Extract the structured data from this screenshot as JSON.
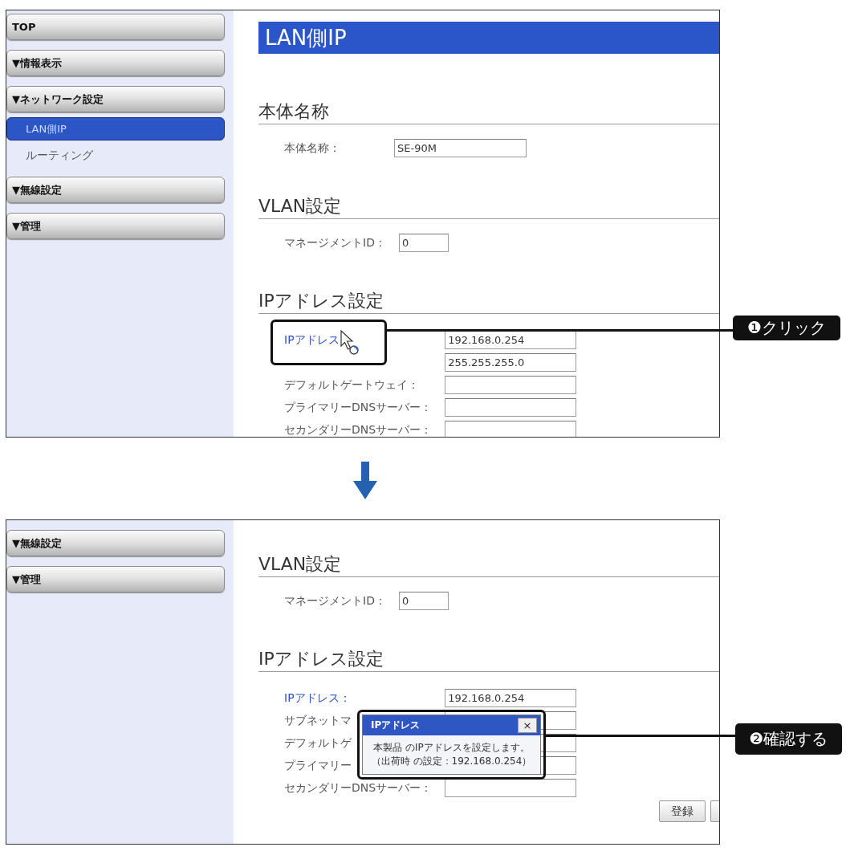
{
  "steps": [
    {
      "sidebar": {
        "items": [
          {
            "kind": "group",
            "label": "TOP",
            "selected": false
          },
          {
            "kind": "group",
            "label": "▼情報表示",
            "selected": false
          },
          {
            "kind": "group",
            "label": "▼ネットワーク設定",
            "selected": false
          },
          {
            "kind": "link",
            "label": "LAN側IP",
            "selected": true
          },
          {
            "kind": "link",
            "label": "ルーティング",
            "selected": false
          },
          {
            "kind": "group",
            "label": "▼無線設定",
            "selected": false
          },
          {
            "kind": "group",
            "label": "▼管理",
            "selected": false
          }
        ]
      },
      "page": {
        "title": "LAN側IP",
        "sections": [
          {
            "heading": "本体名称",
            "fields": [
              {
                "label": "本体名称：",
                "value": "SE-90M",
                "highlighted": false
              }
            ]
          },
          {
            "heading": "VLAN設定",
            "fields": [
              {
                "label": "マネージメントID：",
                "value": "0",
                "highlighted": false
              }
            ]
          },
          {
            "heading": "IPアドレス設定",
            "fields": [
              {
                "label": "IPアドレス",
                "value": "192.168.0.254",
                "highlighted": true
              },
              {
                "value": "255.255.255.0",
                "highlighted": false
              },
              {
                "label": "デフォルトゲートウェイ：",
                "highlighted": false
              },
              {
                "label": "プライマリーDNSサーバー：",
                "highlighted": false
              },
              {
                "label": "セカンダリーDNSサーバー：",
                "highlighted": false
              }
            ]
          }
        ]
      },
      "callout": {
        "text": "❶クリック"
      }
    },
    {
      "sidebar": {
        "items": [
          {
            "kind": "group",
            "label": "▼無線設定",
            "selected": false
          },
          {
            "kind": "group",
            "label": "▼管理",
            "selected": false
          }
        ]
      },
      "page": {
        "sections": [
          {
            "heading": "VLAN設定",
            "fields": [
              {
                "label": "マネージメントID：",
                "value": "0",
                "highlighted": false
              }
            ]
          },
          {
            "heading": "IPアドレス設定",
            "fields": [
              {
                "label": "IPアドレス：",
                "value": "192.168.0.254",
                "highlighted": true
              },
              {
                "label": "サブネットマ",
                "highlighted": false
              },
              {
                "label": "デフォルトゲ",
                "highlighted": false
              },
              {
                "label": "プライマリー",
                "highlighted": false
              },
              {
                "label": "セカンダリーDNSサーバー：",
                "highlighted": false
              }
            ]
          }
        ],
        "buttons": [
          {
            "kind": "button",
            "label": "登録"
          },
          {
            "kind": "clipped"
          }
        ]
      },
      "popup": {
        "title": "IPアドレス",
        "close": "×",
        "lines": [
          "本製品 のIPアドレスを設定します。",
          "（出荷時 の設定：192.168.0.254）"
        ]
      },
      "callout": {
        "text": "❷確認する"
      }
    }
  ]
}
